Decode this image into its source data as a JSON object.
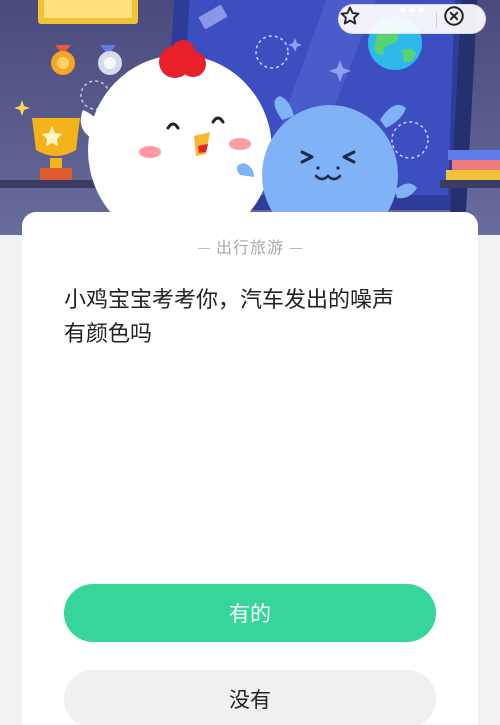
{
  "banner": {
    "top_menu": {
      "favorite_icon": "star-outline-icon",
      "more_icon": "three-dots-icon",
      "close_icon": "close-circle-icon"
    }
  },
  "card": {
    "category": "出行旅游",
    "question": "小鸡宝宝考考你，汽车发出的噪声\n有颜色吗"
  },
  "answers": [
    {
      "label": "有的"
    },
    {
      "label": "没有"
    }
  ],
  "colors": {
    "primary_answer": "#36d59a",
    "secondary_answer": "#f0f0f3",
    "banner_bg": "#4a4b7c"
  }
}
